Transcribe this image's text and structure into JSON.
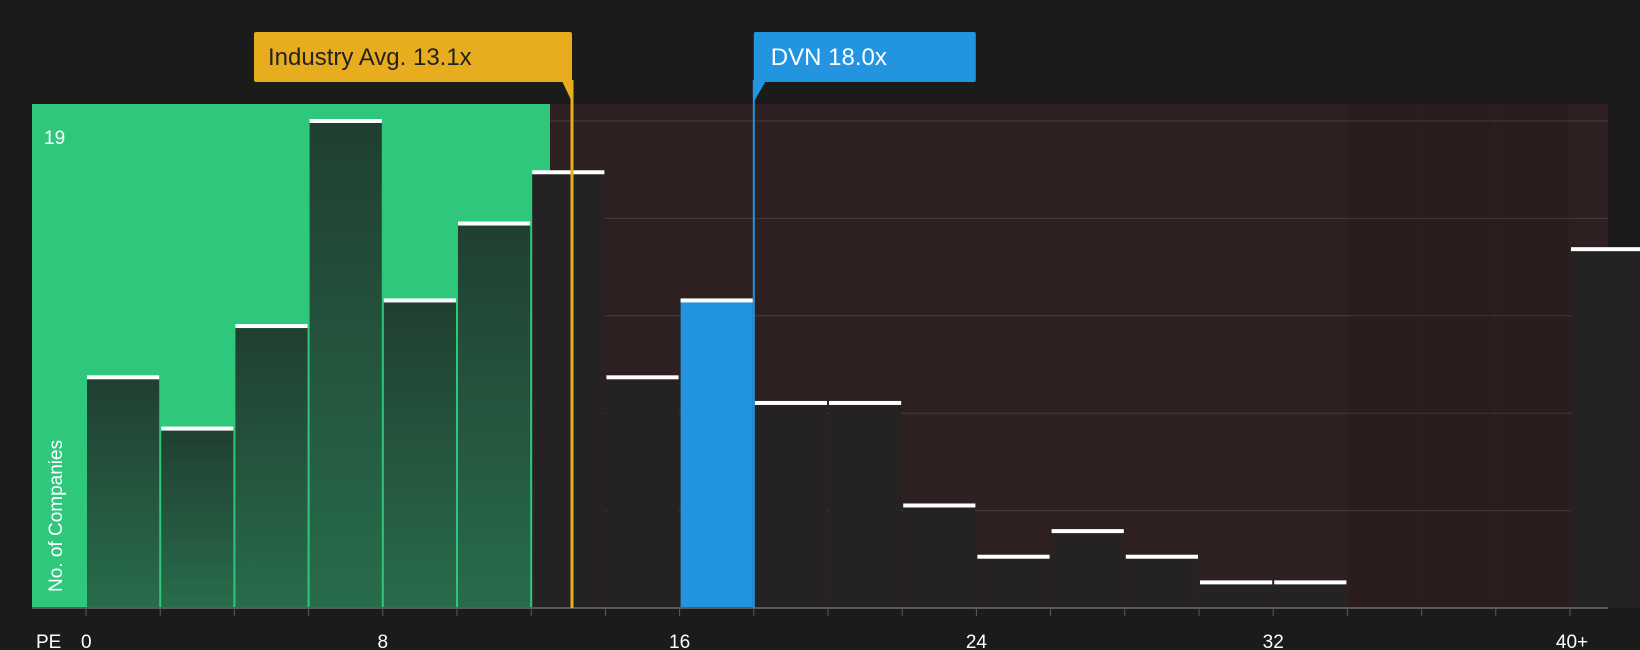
{
  "chart_data": {
    "type": "bar",
    "xlabel": "PE",
    "ylabel": "No. of Companies",
    "y_top_label": "19",
    "ylim": [
      0,
      19
    ],
    "x_ticks": [
      {
        "value": 0,
        "label": "0"
      },
      {
        "value": 8,
        "label": "8"
      },
      {
        "value": 16,
        "label": "16"
      },
      {
        "value": 24,
        "label": "24"
      },
      {
        "value": 32,
        "label": "32"
      },
      {
        "value": 40,
        "label": "40+"
      }
    ],
    "bins": [
      {
        "start": 0,
        "end": 2,
        "count": 9
      },
      {
        "start": 2,
        "end": 4,
        "count": 7
      },
      {
        "start": 4,
        "end": 6,
        "count": 11
      },
      {
        "start": 6,
        "end": 8,
        "count": 19
      },
      {
        "start": 8,
        "end": 10,
        "count": 12
      },
      {
        "start": 10,
        "end": 12,
        "count": 15
      },
      {
        "start": 12,
        "end": 14,
        "count": 17
      },
      {
        "start": 14,
        "end": 16,
        "count": 9
      },
      {
        "start": 16,
        "end": 18,
        "count": 12,
        "highlight": true
      },
      {
        "start": 18,
        "end": 20,
        "count": 8
      },
      {
        "start": 20,
        "end": 22,
        "count": 8
      },
      {
        "start": 22,
        "end": 24,
        "count": 4
      },
      {
        "start": 24,
        "end": 26,
        "count": 2
      },
      {
        "start": 26,
        "end": 28,
        "count": 3
      },
      {
        "start": 28,
        "end": 30,
        "count": 2
      },
      {
        "start": 30,
        "end": 32,
        "count": 1
      },
      {
        "start": 32,
        "end": 34,
        "count": 1
      },
      {
        "start": 34,
        "end": 36,
        "count": 0
      },
      {
        "start": 36,
        "end": 38,
        "count": 0
      },
      {
        "start": 38,
        "end": 40,
        "count": 0
      },
      {
        "start": 40,
        "end": 42,
        "count": 14
      }
    ],
    "industry_avg": {
      "value": 13.1,
      "label": "Industry Avg. 13.1x",
      "color": "#e8ad1f"
    },
    "company": {
      "value": 18.0,
      "label": "DVN 18.0x",
      "color": "#2394e0"
    },
    "colors": {
      "below_region": "#2fc77c",
      "above_region": "#2e1f20",
      "bar_in_green": "#23523a",
      "bar_default": "#242222",
      "highlight_bar": "#2394e0",
      "bar_cap": "#ffffff",
      "background": "#1b1b1b"
    }
  }
}
